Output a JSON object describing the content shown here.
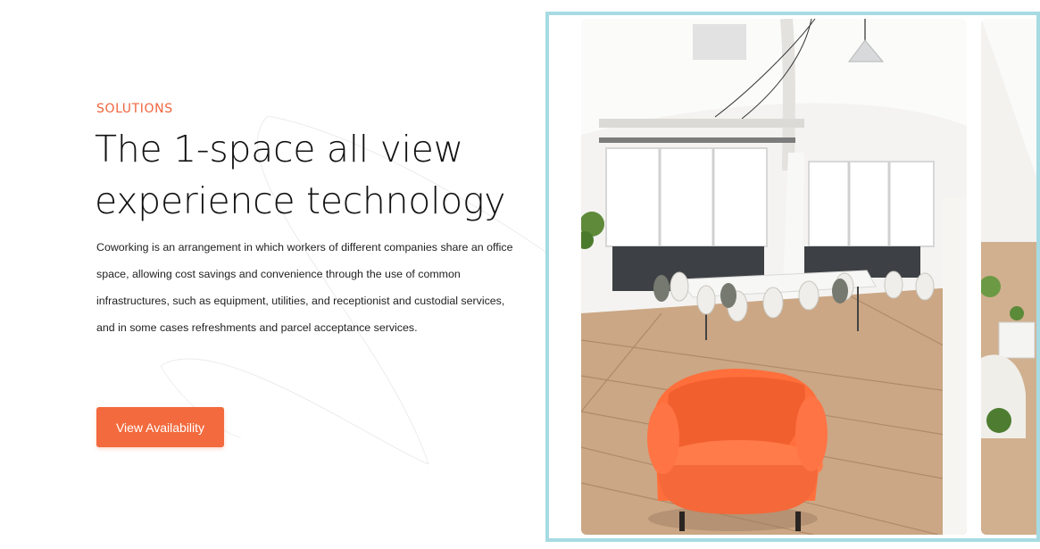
{
  "section": {
    "eyebrow": "SOLUTIONS",
    "headline": "The 1-space all view experience technology",
    "body": "Coworking is an arrangement in which workers of different companies share an office space, allowing cost savings and convenience through the use of common infrastructures, such as equipment, utilities, and receptionist and custodial services, and in some cases refreshments and parcel acceptance services.",
    "cta_label": "View Availability"
  },
  "gallery": {
    "slides": [
      {
        "subject": "coworking-space-photo",
        "description_icon": "orange-armchair"
      },
      {
        "subject": "coworking-lounge-photo"
      }
    ]
  },
  "colors": {
    "accent": "#f26a3d",
    "eyebrow": "#f0643c",
    "frame_border": "#a6dbe3",
    "text": "#111111"
  }
}
